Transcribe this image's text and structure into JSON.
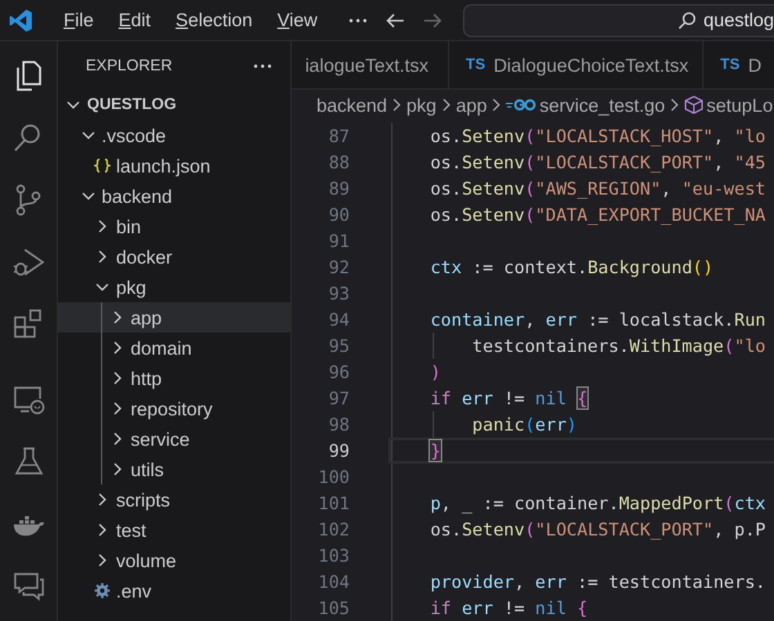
{
  "title_bar": {
    "menus": [
      {
        "label": "File"
      },
      {
        "label": "Edit"
      },
      {
        "label": "Selection"
      },
      {
        "label": "View"
      }
    ],
    "search": {
      "value": "questlog"
    }
  },
  "activity_bar": {
    "items": [
      {
        "kind": "files",
        "selected": true
      },
      {
        "kind": "search",
        "selected": false
      },
      {
        "kind": "source-control",
        "selected": false
      },
      {
        "kind": "run-debug",
        "selected": false
      },
      {
        "kind": "extensions",
        "selected": false
      },
      {
        "kind": "remote",
        "selected": false
      },
      {
        "kind": "testing",
        "selected": false
      },
      {
        "kind": "docker",
        "selected": false
      },
      {
        "kind": "chat",
        "selected": false
      }
    ]
  },
  "explorer": {
    "title": "EXPLORER",
    "tree": [
      {
        "label": "QUESTLOG",
        "kind": "root",
        "expanded": true,
        "selected": false,
        "children": [
          {
            "label": ".vscode",
            "kind": "folder",
            "expanded": true,
            "selected": false,
            "children": [
              {
                "label": "launch.json",
                "kind": "json",
                "selected": false
              }
            ]
          },
          {
            "label": "backend",
            "kind": "folder",
            "expanded": true,
            "selected": false,
            "children": [
              {
                "label": "bin",
                "kind": "folder",
                "expanded": false,
                "selected": false
              },
              {
                "label": "docker",
                "kind": "folder",
                "expanded": false,
                "selected": false
              },
              {
                "label": "pkg",
                "kind": "folder",
                "expanded": true,
                "selected": false,
                "children": [
                  {
                    "label": "app",
                    "kind": "folder",
                    "expanded": false,
                    "selected": true
                  },
                  {
                    "label": "domain",
                    "kind": "folder",
                    "expanded": false,
                    "selected": false
                  },
                  {
                    "label": "http",
                    "kind": "folder",
                    "expanded": false,
                    "selected": false
                  },
                  {
                    "label": "repository",
                    "kind": "folder",
                    "expanded": false,
                    "selected": false
                  },
                  {
                    "label": "service",
                    "kind": "folder",
                    "expanded": false,
                    "selected": false
                  },
                  {
                    "label": "utils",
                    "kind": "folder",
                    "expanded": false,
                    "selected": false
                  }
                ]
              },
              {
                "label": "scripts",
                "kind": "folder",
                "expanded": false,
                "selected": false
              },
              {
                "label": "test",
                "kind": "folder",
                "expanded": false,
                "selected": false
              },
              {
                "label": "volume",
                "kind": "folder",
                "expanded": false,
                "selected": false
              },
              {
                "label": ".env",
                "kind": "settings",
                "selected": false
              }
            ]
          }
        ]
      }
    ]
  },
  "tabs": [
    {
      "label": "ialogueText.tsx"
    },
    {
      "badge": "TS",
      "label": "DialogueChoiceText.tsx"
    },
    {
      "badge": "TS",
      "label": "D"
    }
  ],
  "breadcrumb": [
    {
      "label": "backend",
      "kind": "folder"
    },
    {
      "label": "pkg",
      "kind": "folder"
    },
    {
      "label": "app",
      "kind": "folder"
    },
    {
      "label": "service_test.go",
      "kind": "go-file"
    },
    {
      "label": "setupLo",
      "kind": "symbol"
    }
  ],
  "code": [
    {
      "number": "87",
      "current": false,
      "tokens": [
        {
          "kind": "plain",
          "t": "    os."
        },
        {
          "kind": "function",
          "t": "Setenv"
        },
        {
          "kind": "bracket2",
          "t": "("
        },
        {
          "kind": "string",
          "t": "\"LOCALSTACK_HOST\""
        },
        {
          "kind": "plain",
          "t": ", "
        },
        {
          "kind": "string",
          "t": "\"lo"
        }
      ]
    },
    {
      "number": "88",
      "current": false,
      "tokens": [
        {
          "kind": "plain",
          "t": "    os."
        },
        {
          "kind": "function",
          "t": "Setenv"
        },
        {
          "kind": "bracket2",
          "t": "("
        },
        {
          "kind": "string",
          "t": "\"LOCALSTACK_PORT\""
        },
        {
          "kind": "plain",
          "t": ", "
        },
        {
          "kind": "string",
          "t": "\"45"
        }
      ]
    },
    {
      "number": "89",
      "current": false,
      "tokens": [
        {
          "kind": "plain",
          "t": "    os."
        },
        {
          "kind": "function",
          "t": "Setenv"
        },
        {
          "kind": "bracket2",
          "t": "("
        },
        {
          "kind": "string",
          "t": "\"AWS_REGION\""
        },
        {
          "kind": "plain",
          "t": ", "
        },
        {
          "kind": "string",
          "t": "\"eu-west"
        }
      ]
    },
    {
      "number": "90",
      "current": false,
      "tokens": [
        {
          "kind": "plain",
          "t": "    os."
        },
        {
          "kind": "function",
          "t": "Setenv"
        },
        {
          "kind": "bracket2",
          "t": "("
        },
        {
          "kind": "string",
          "t": "\"DATA_EXPORT_BUCKET_NA"
        }
      ]
    },
    {
      "number": "91",
      "current": false
    },
    {
      "number": "92",
      "current": false,
      "tokens": [
        {
          "kind": "variable",
          "t": "    ctx"
        },
        {
          "kind": "plain",
          "t": " := context."
        },
        {
          "kind": "function",
          "t": "Background"
        },
        {
          "kind": "bracket1",
          "t": "()"
        }
      ]
    },
    {
      "number": "93",
      "current": false
    },
    {
      "number": "94",
      "current": false,
      "tokens": [
        {
          "kind": "variable",
          "t": "    container"
        },
        {
          "kind": "plain",
          "t": ", "
        },
        {
          "kind": "variable",
          "t": "err"
        },
        {
          "kind": "plain",
          "t": " := localstack."
        },
        {
          "kind": "function",
          "t": "Run"
        }
      ]
    },
    {
      "number": "95",
      "current": false,
      "tokens": [
        {
          "kind": "plain",
          "t": "        testcontainers."
        },
        {
          "kind": "function",
          "t": "WithImage"
        },
        {
          "kind": "bracket2",
          "t": "("
        },
        {
          "kind": "string",
          "t": "\"lo"
        }
      ]
    },
    {
      "number": "96",
      "current": false,
      "tokens": [
        {
          "kind": "bracket2",
          "t": "    )"
        }
      ]
    },
    {
      "number": "97",
      "current": false,
      "tokens": [
        {
          "kind": "keyword",
          "t": "    if "
        },
        {
          "kind": "variable",
          "t": "err"
        },
        {
          "kind": "plain",
          "t": " != "
        },
        {
          "kind": "constant",
          "t": "nil "
        },
        {
          "kind": "bracket2",
          "t": "{",
          "match": true
        }
      ]
    },
    {
      "number": "98",
      "current": false,
      "tokens": [
        {
          "kind": "function",
          "t": "        panic"
        },
        {
          "kind": "bracket3",
          "t": "("
        },
        {
          "kind": "variable",
          "t": "err"
        },
        {
          "kind": "bracket3",
          "t": ")"
        }
      ]
    },
    {
      "number": "99",
      "current": true,
      "tokens": [
        {
          "kind": "bracket2",
          "t": "    }",
          "match": true
        }
      ]
    },
    {
      "number": "100",
      "current": false
    },
    {
      "number": "101",
      "current": false,
      "tokens": [
        {
          "kind": "variable",
          "t": "    p"
        },
        {
          "kind": "plain",
          "t": ", _ := container."
        },
        {
          "kind": "function",
          "t": "MappedPort"
        },
        {
          "kind": "bracket2",
          "t": "("
        },
        {
          "kind": "variable",
          "t": "ctx"
        }
      ]
    },
    {
      "number": "102",
      "current": false,
      "tokens": [
        {
          "kind": "plain",
          "t": "    os."
        },
        {
          "kind": "function",
          "t": "Setenv"
        },
        {
          "kind": "bracket2",
          "t": "("
        },
        {
          "kind": "string",
          "t": "\"LOCALSTACK_PORT\""
        },
        {
          "kind": "plain",
          "t": ", p.P"
        }
      ]
    },
    {
      "number": "103",
      "current": false
    },
    {
      "number": "104",
      "current": false,
      "tokens": [
        {
          "kind": "variable",
          "t": "    provider"
        },
        {
          "kind": "plain",
          "t": ", "
        },
        {
          "kind": "variable",
          "t": "err"
        },
        {
          "kind": "plain",
          "t": " := testcontainers."
        }
      ]
    },
    {
      "number": "105",
      "current": false,
      "tokens": [
        {
          "kind": "keyword",
          "t": "    if "
        },
        {
          "kind": "variable",
          "t": "err"
        },
        {
          "kind": "plain",
          "t": " != "
        },
        {
          "kind": "constant",
          "t": "nil "
        },
        {
          "kind": "bracket2",
          "t": "{"
        }
      ]
    }
  ]
}
